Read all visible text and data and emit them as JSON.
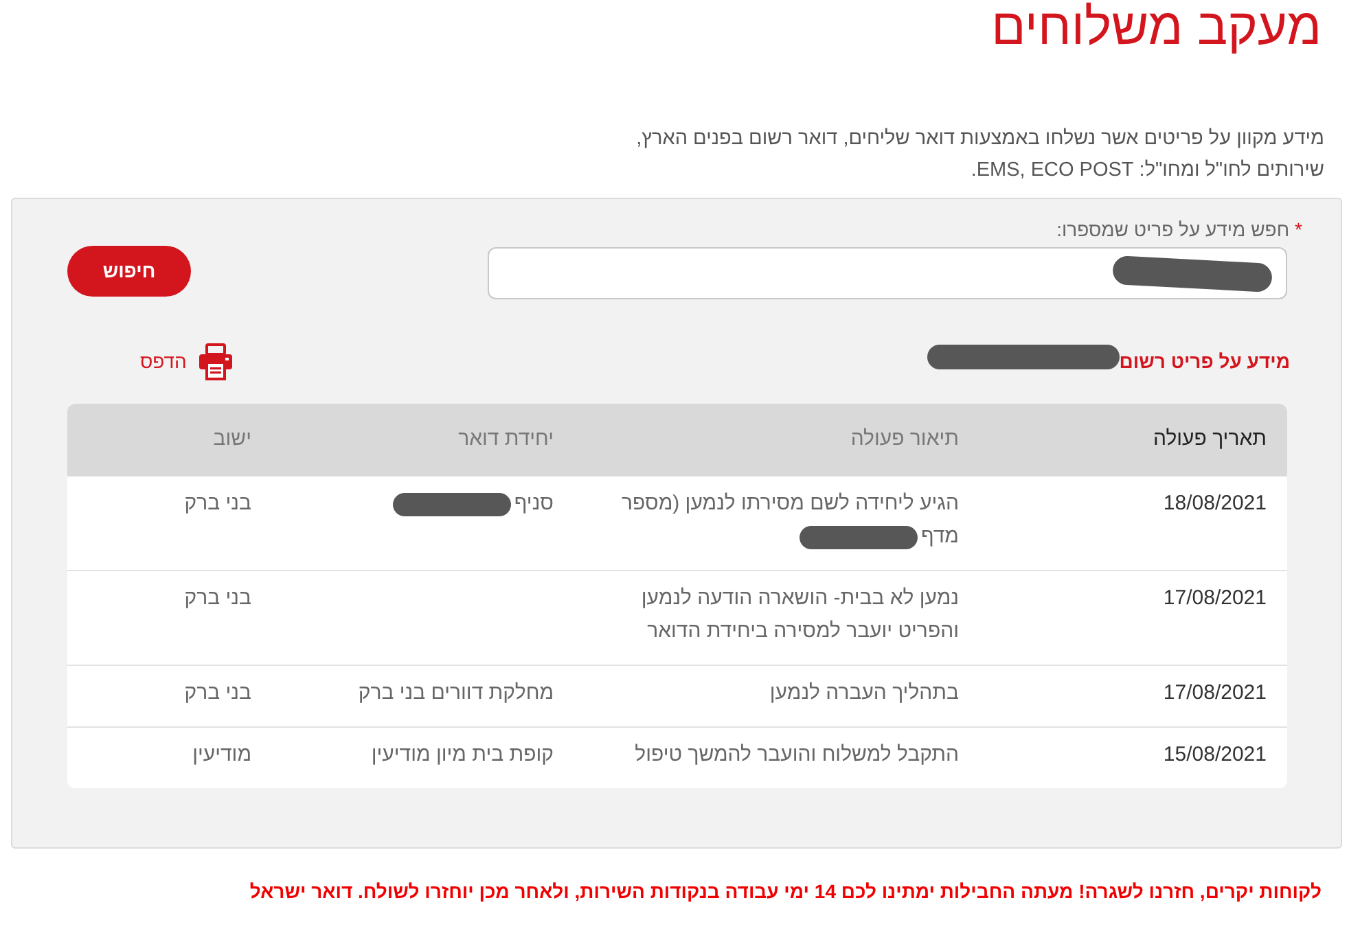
{
  "page": {
    "title": "מעקב משלוחים",
    "description": "מידע מקוון על פריטים אשר נשלחו באמצעות דואר שליחים, דואר רשום בפנים הארץ, שירותים לחו\"ל ומחו\"ל: EMS, ECO POST."
  },
  "search": {
    "required_mark": "*",
    "label": "חפש מידע על פריט שמספרו:",
    "value_redacted": true,
    "button": "חיפוש"
  },
  "result": {
    "heading": "מידע על פריט רשום",
    "number_redacted": true,
    "print_label": "הדפס"
  },
  "table": {
    "columns": [
      "תאריך פעולה",
      "תיאור פעולה",
      "יחידת דואר",
      "ישוב"
    ],
    "rows": [
      [
        {
          "text": "18/08/2021",
          "redacted": false
        },
        {
          "text": "הגיע ליחידה לשם מסירתו לנמען (מספר מדף",
          "redacted": true
        },
        {
          "text": "סניף",
          "redacted": true
        },
        {
          "text": "בני ברק",
          "redacted": false
        }
      ],
      [
        {
          "text": "17/08/2021",
          "redacted": false
        },
        {
          "text": "נמען לא בבית- הושארה הודעה לנמען והפריט יועבר למסירה ביחידת הדואר",
          "redacted": false
        },
        {
          "redacted": false
        },
        {
          "text": "בני ברק",
          "redacted": false
        }
      ],
      [
        {
          "text": "17/08/2021",
          "redacted": false
        },
        {
          "text": "בתהליך העברה לנמען",
          "redacted": false
        },
        {
          "text": "מחלקת דוורים בני ברק",
          "redacted": false
        },
        {
          "text": "בני ברק",
          "redacted": false
        }
      ],
      [
        {
          "text": "15/08/2021",
          "redacted": false
        },
        {
          "text": "התקבל למשלוח והועבר להמשך טיפול",
          "redacted": false
        },
        {
          "text": "קופת בית מיון מודיעין",
          "redacted": false
        },
        {
          "text": "מודיעין",
          "redacted": false
        }
      ]
    ]
  },
  "notice": "לקוחות יקרים, חזרנו לשגרה! מעתה החבילות ימתינו לכם 14 ימי עבודה בנקודות השירות, ולאחר מכן יוחזרו לשולח. דואר ישראל"
}
